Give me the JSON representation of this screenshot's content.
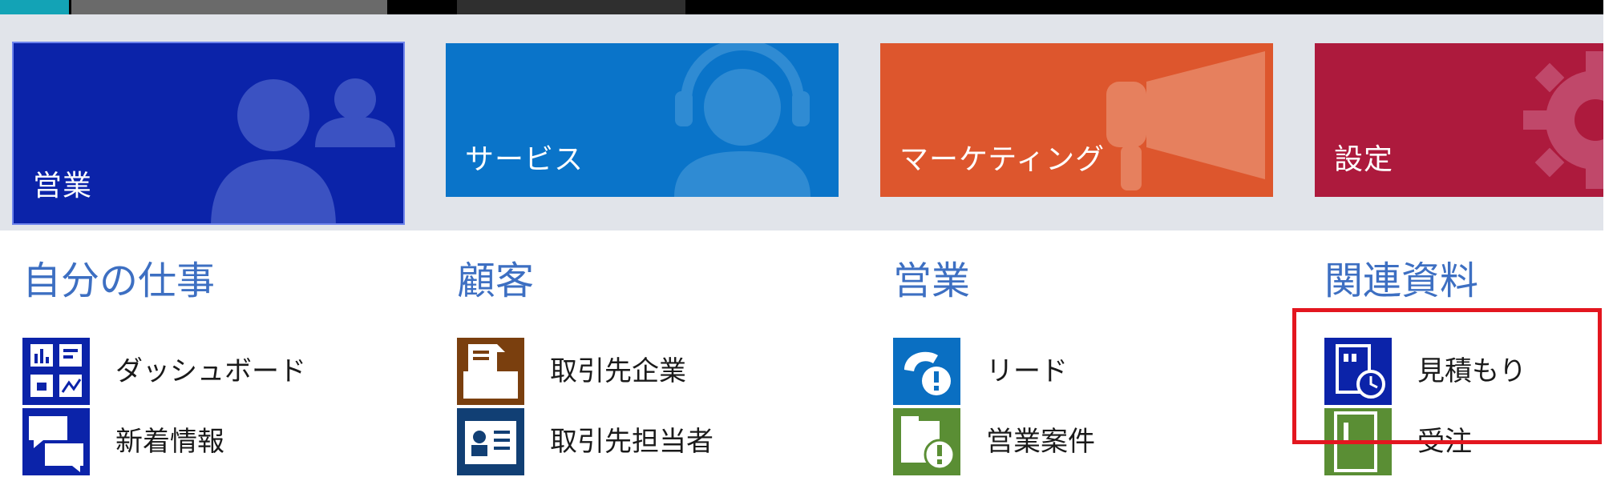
{
  "tiles": [
    {
      "label": "営業",
      "color": "#0b23a9"
    },
    {
      "label": "サービス",
      "color": "#0a74c9"
    },
    {
      "label": "マーケティング",
      "color": "#dd562d"
    },
    {
      "label": "設定",
      "color": "#ad1a3d"
    }
  ],
  "columns": [
    {
      "title": "自分の仕事",
      "items": [
        {
          "label": "ダッシュボード"
        },
        {
          "label": "新着情報"
        }
      ]
    },
    {
      "title": "顧客",
      "items": [
        {
          "label": "取引先企業"
        },
        {
          "label": "取引先担当者"
        }
      ]
    },
    {
      "title": "営業",
      "items": [
        {
          "label": "リード"
        },
        {
          "label": "営業案件"
        }
      ]
    },
    {
      "title": "関連資料",
      "items": [
        {
          "label": "見積もり"
        },
        {
          "label": "受注"
        }
      ]
    }
  ],
  "colors": {
    "heading": "#3d6fc2",
    "icon_blue": "#0b23a9",
    "icon_brown": "#7a3f0e",
    "icon_navy": "#113f74",
    "icon_sky": "#0a6fc2",
    "icon_green": "#5a8e34",
    "highlight": "#e3161f"
  }
}
